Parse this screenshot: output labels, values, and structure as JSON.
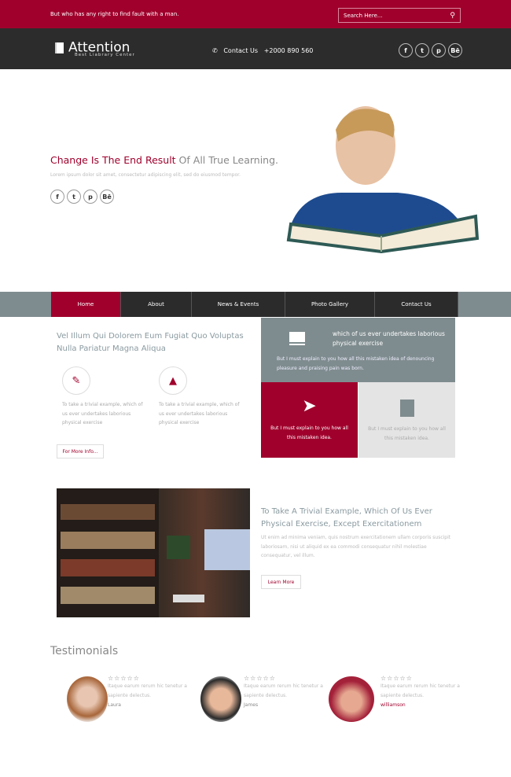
{
  "topbar": {
    "message": "But who has any right to find fault with a man.",
    "search_placeholder": "Search Here..."
  },
  "header": {
    "logo_name": "Attention",
    "logo_tagline": "Best Liabrary Center",
    "contact_label": "Contact Us",
    "phone": "+2000 890 560",
    "social": [
      "f",
      "t",
      "p",
      "Bē"
    ]
  },
  "hero": {
    "title_strong": "Change Is The End Result",
    "title_rest": " Of All True Learning.",
    "text": "Lorem ipsum dolor sit amet, consectetur adipiscing elit, sed do eiusmod tempor."
  },
  "nav": {
    "items": [
      {
        "label": "Home"
      },
      {
        "label": "About"
      },
      {
        "label": "News & Events"
      },
      {
        "label": "Photo Gallery"
      },
      {
        "label": "Contact Us"
      }
    ]
  },
  "features": {
    "heading": "Vel Illum Qui Dolorem Eum Fugiat Quo Voluptas Nulla Pariatur Magna Aliqua",
    "items": [
      {
        "text": "To take a trivial example, which of us ever undertakes laborious physical exercise"
      },
      {
        "text": "To take a trivial example, which of us ever undertakes laborious physical exercise"
      }
    ],
    "button": "For More Info..."
  },
  "boxes": {
    "gray_title": "which of us ever undertakes laborious physical exercise",
    "gray_text": "But I must explain to you how all this mistaken idea of denouncing pleasure and praising pain was born.",
    "red_text": "But I must explain to you how all this mistaken idea.",
    "light_text": "But I must explain to you how all this mistaken idea."
  },
  "about": {
    "heading": "To Take A Trivial Example, Which Of Us Ever Physical Exercise, Except Exercitationem",
    "text": "Ut enim ad minima veniam, quis nostrum exercitationem ullam corporis suscipit laboriosam, nisi ut aliquid ex ea commodi consequatur nihil molestiae consequatur, vel illum.",
    "button": "Learn More"
  },
  "testimonials": {
    "heading": "Testimonials",
    "items": [
      {
        "stars": "☆☆☆☆☆",
        "quote": "Itaque earum rerum hic tenetur a sapiente delectus.",
        "name": "Laura"
      },
      {
        "stars": "☆☆☆☆☆",
        "quote": "Itaque earum rerum hic tenetur a sapiente delectus.",
        "name": "James"
      },
      {
        "stars": "☆☆☆☆☆",
        "quote": "Itaque earum rerum hic tenetur a sapiente delectus.",
        "name": "williamson"
      }
    ]
  },
  "colors": {
    "accent": "#a0002c",
    "dark": "#2c2c2c",
    "gray": "#7f8c8f"
  }
}
